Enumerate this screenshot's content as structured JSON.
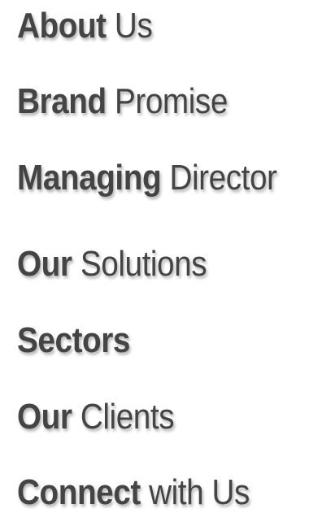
{
  "menu": {
    "items": [
      {
        "bold": "About",
        "regular": " Us"
      },
      {
        "bold": "Brand",
        "regular": " Promise"
      },
      {
        "bold": "Managing",
        "regular": " Director"
      },
      {
        "bold": "Our",
        "regular": " Solutions"
      },
      {
        "bold": "Sectors",
        "regular": ""
      },
      {
        "bold": "Our",
        "regular": " Clients"
      },
      {
        "bold": "Connect",
        "regular": " with Us"
      }
    ]
  },
  "colors": {
    "text": "#444444",
    "background": "#ffffff"
  }
}
